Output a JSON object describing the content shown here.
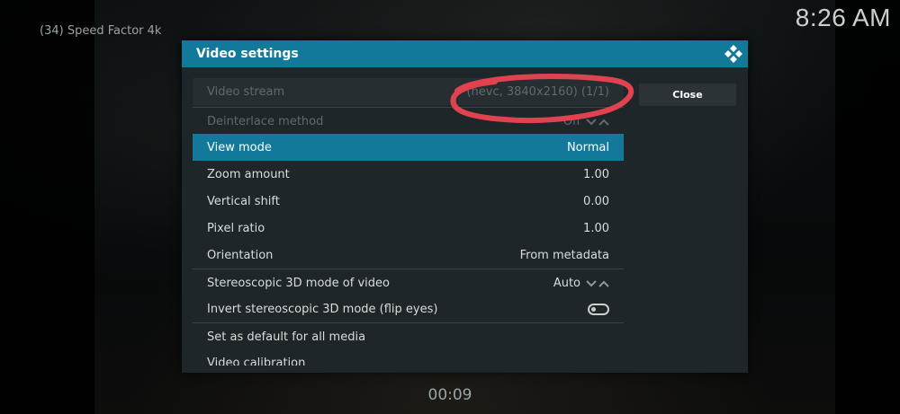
{
  "overlay": {
    "media_number": "(34)",
    "media_title": "Speed Factor 4k",
    "clock": "8:26 AM",
    "elapsed": "00:09"
  },
  "dialog": {
    "title": "Video settings",
    "close_label": "Close",
    "rows": [
      {
        "label": "Video stream",
        "value": "(hevc, 3840x2160) (1/1)"
      },
      {
        "label": "Deinterlace method",
        "value": "Off"
      },
      {
        "label": "View mode",
        "value": "Normal"
      },
      {
        "label": "Zoom amount",
        "value": "1.00"
      },
      {
        "label": "Vertical shift",
        "value": "0.00"
      },
      {
        "label": "Pixel ratio",
        "value": "1.00"
      },
      {
        "label": "Orientation",
        "value": "From metadata"
      },
      {
        "label": "Stereoscopic 3D mode of video",
        "value": "Auto"
      },
      {
        "label": "Invert stereoscopic 3D mode (flip eyes)",
        "value": ""
      },
      {
        "label": "Set as default for all media",
        "value": ""
      },
      {
        "label": "Video calibration",
        "value": ""
      }
    ]
  },
  "colors": {
    "accent": "#12799a",
    "dialog_bg": "#1f2629",
    "annotation": "#e0424f"
  },
  "icons": {
    "logo": "kodi-logo-icon",
    "spinner": "chevron-up-down-icon",
    "toggle": "toggle-off-icon"
  }
}
